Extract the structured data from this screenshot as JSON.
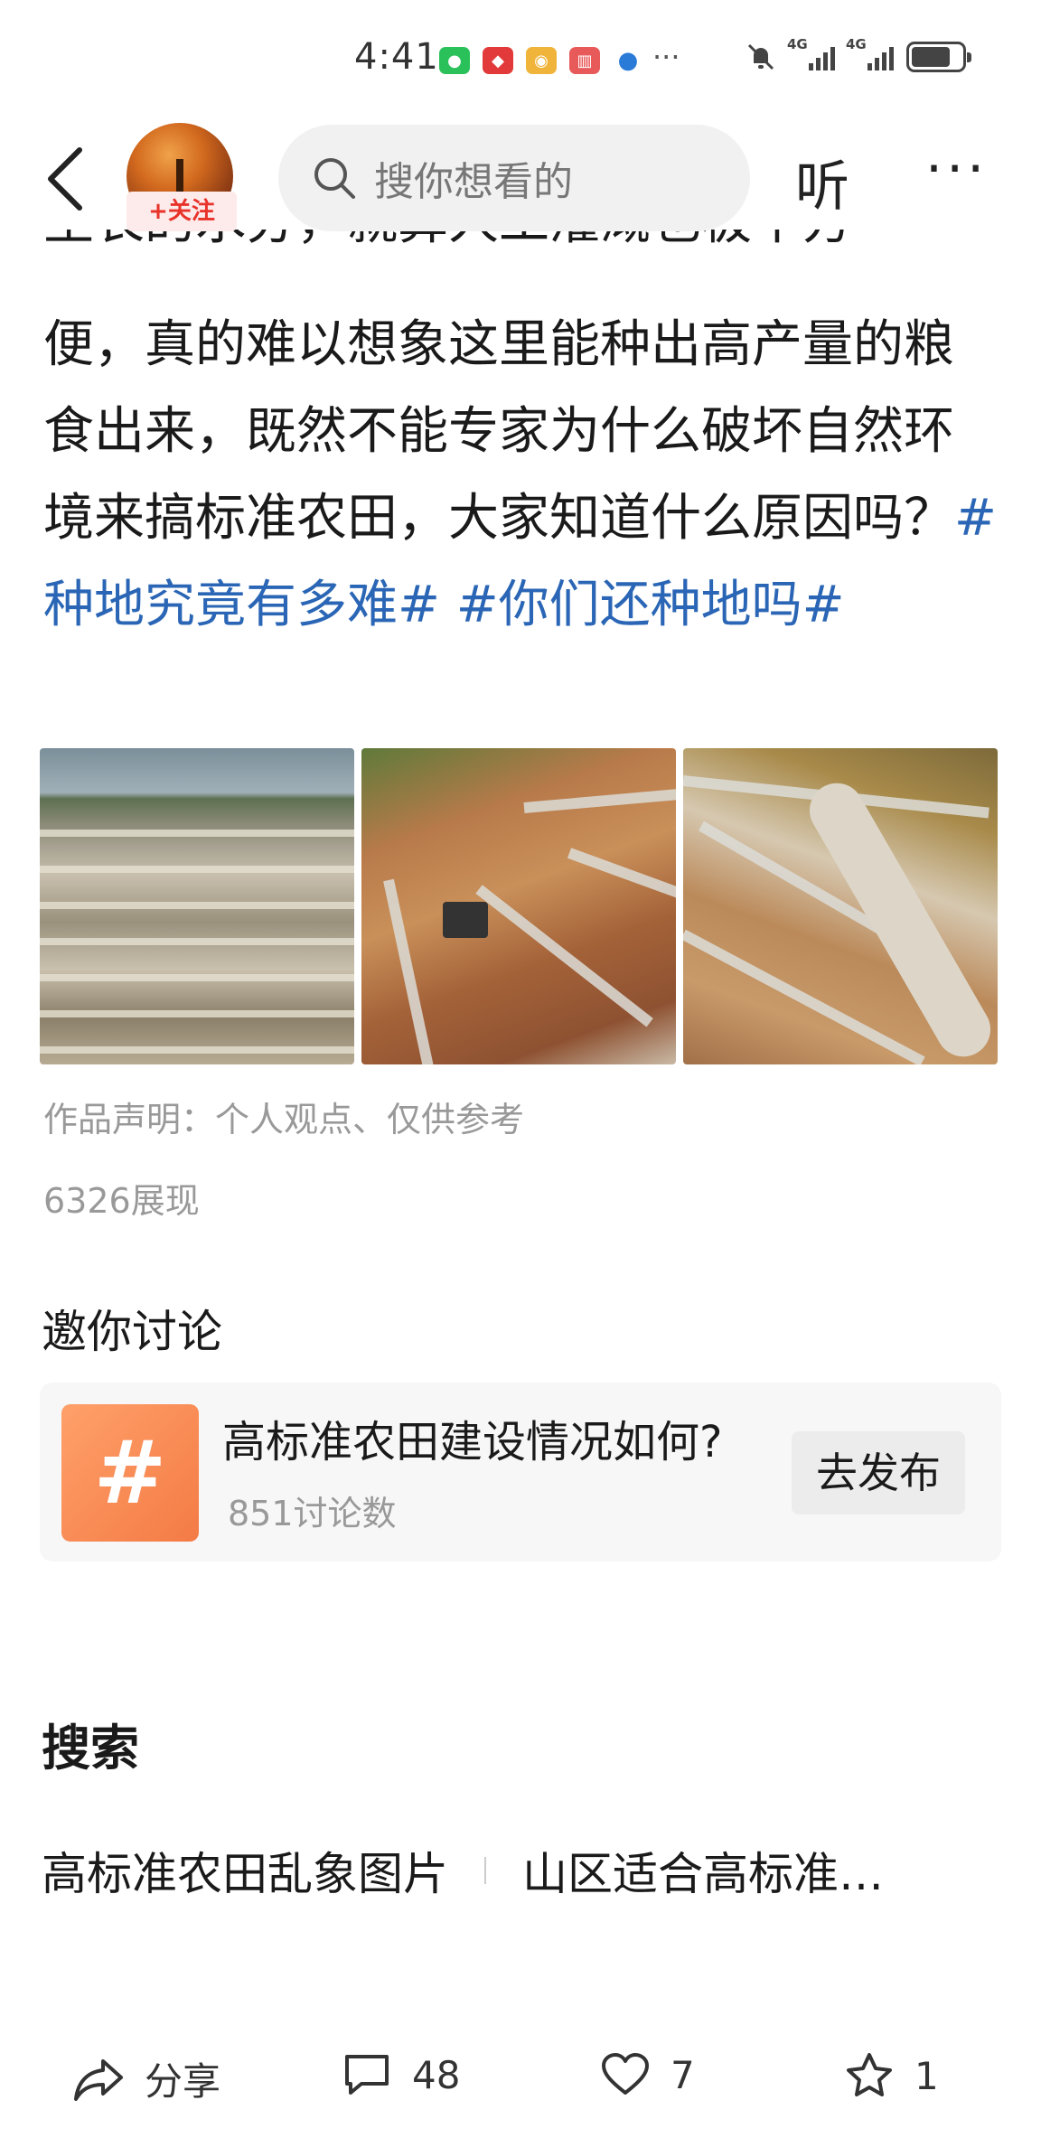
{
  "status_bar": {
    "time": "4:41",
    "more": "···",
    "network1": "4G",
    "network2": "4G"
  },
  "nav": {
    "follow_label": "+关注",
    "search_placeholder": "搜你想看的",
    "listen_label": "听",
    "more_label": "···"
  },
  "article": {
    "cut_line": "生长的水分，就算人工灌溉也极不方",
    "body_part1": "便，真的难以想象这里能种出高产量的粮食出来，既然不能专家为什么破坏自然环境来搞标准农田，大家知道什么原因吗？",
    "hashtag1": "#种地究竟有多难#",
    "hashtag2": "#你们还种地吗#"
  },
  "meta": {
    "statement": "作品声明：个人观点、仅供参考",
    "views": "6326展现"
  },
  "discussion": {
    "title": "邀你讨论",
    "topic_icon": "#",
    "topic_text": "高标准农田建设情况如何?",
    "topic_count": "851讨论数",
    "publish_label": "去发布"
  },
  "search": {
    "title": "搜索",
    "suggestions": [
      "高标准农田乱象图片",
      "山区适合高标准…"
    ]
  },
  "toolbar": {
    "share_label": "分享",
    "comment_count": "48",
    "like_count": "7",
    "favorite_count": "1"
  },
  "colors": {
    "hashtag": "#2a66b5",
    "follow": "#e8332a",
    "topic_icon_bg": "#f47b45"
  }
}
